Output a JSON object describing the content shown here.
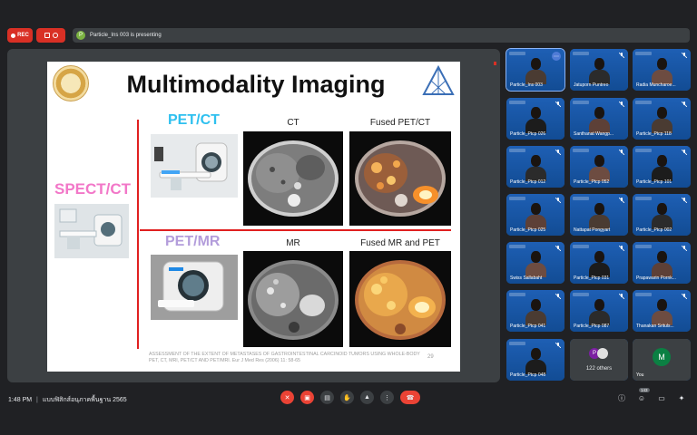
{
  "top": {
    "rec_label": "REC",
    "presenting_avatar": "P",
    "presenting_text": "Particle_Ins 003 is presenting"
  },
  "slide": {
    "title": "Multimodality Imaging",
    "pet_ct": "PET/CT",
    "spect_ct": "SPECT/CT",
    "pet_mr": "PET/MR",
    "ct": "CT",
    "fused_pet_ct": "Fused PET/CT",
    "mr": "MR",
    "fused_mr_pet": "Fused MR and PET",
    "reference": "ASSESSMENT OF THE EXTENT OF METASTASES OF GASTROINTESTINAL CARCINOID TUMORS USING WHOLE-BODY PET, CT, MRI, PET/CT AND PET/MRI. Eur J Med Res (2006) 11: 58-65",
    "page_number": "29"
  },
  "participants": [
    {
      "name": "Particle_Ins 003",
      "active": true
    },
    {
      "name": "Jatuporn Puntreo"
    },
    {
      "name": "Radia Muncharoe..."
    },
    {
      "name": "Particle_Ptcp 026"
    },
    {
      "name": "Santhanat Wangp..."
    },
    {
      "name": "Particle_Ptcp 118"
    },
    {
      "name": "Particle_Ptcp 012"
    },
    {
      "name": "Particle_Ptcp 052"
    },
    {
      "name": "Particle_Ptcp 101"
    },
    {
      "name": "Particle_Ptcp 025"
    },
    {
      "name": "Nattapat Pongyart"
    },
    {
      "name": "Particle_Ptcp 002"
    },
    {
      "name": "Swiss Sallabaht"
    },
    {
      "name": "Particle_Ptcp 031"
    },
    {
      "name": "Prapawarin Pornk..."
    },
    {
      "name": "Particle_Ptcp 041"
    },
    {
      "name": "Particle_Ptcp 087"
    },
    {
      "name": "Thanakan Srituls..."
    },
    {
      "name": "Particle_Ptcp 048"
    }
  ],
  "others": {
    "avatar": "P",
    "label": "122 others"
  },
  "you": {
    "avatar": "M",
    "label": "You"
  },
  "bottom": {
    "time": "1:48 PM",
    "meeting_title": "แบบฟิสิกส์อนุภาคพื้นฐาน 2565",
    "participant_count": "143"
  },
  "colors": {
    "record_red": "#d93025",
    "pet_ct": "#2fc0ef",
    "spect_ct": "#f277c8",
    "pet_mr": "#b39ddb",
    "divider_red": "#e02020",
    "tile_blue": "#1565c0"
  }
}
